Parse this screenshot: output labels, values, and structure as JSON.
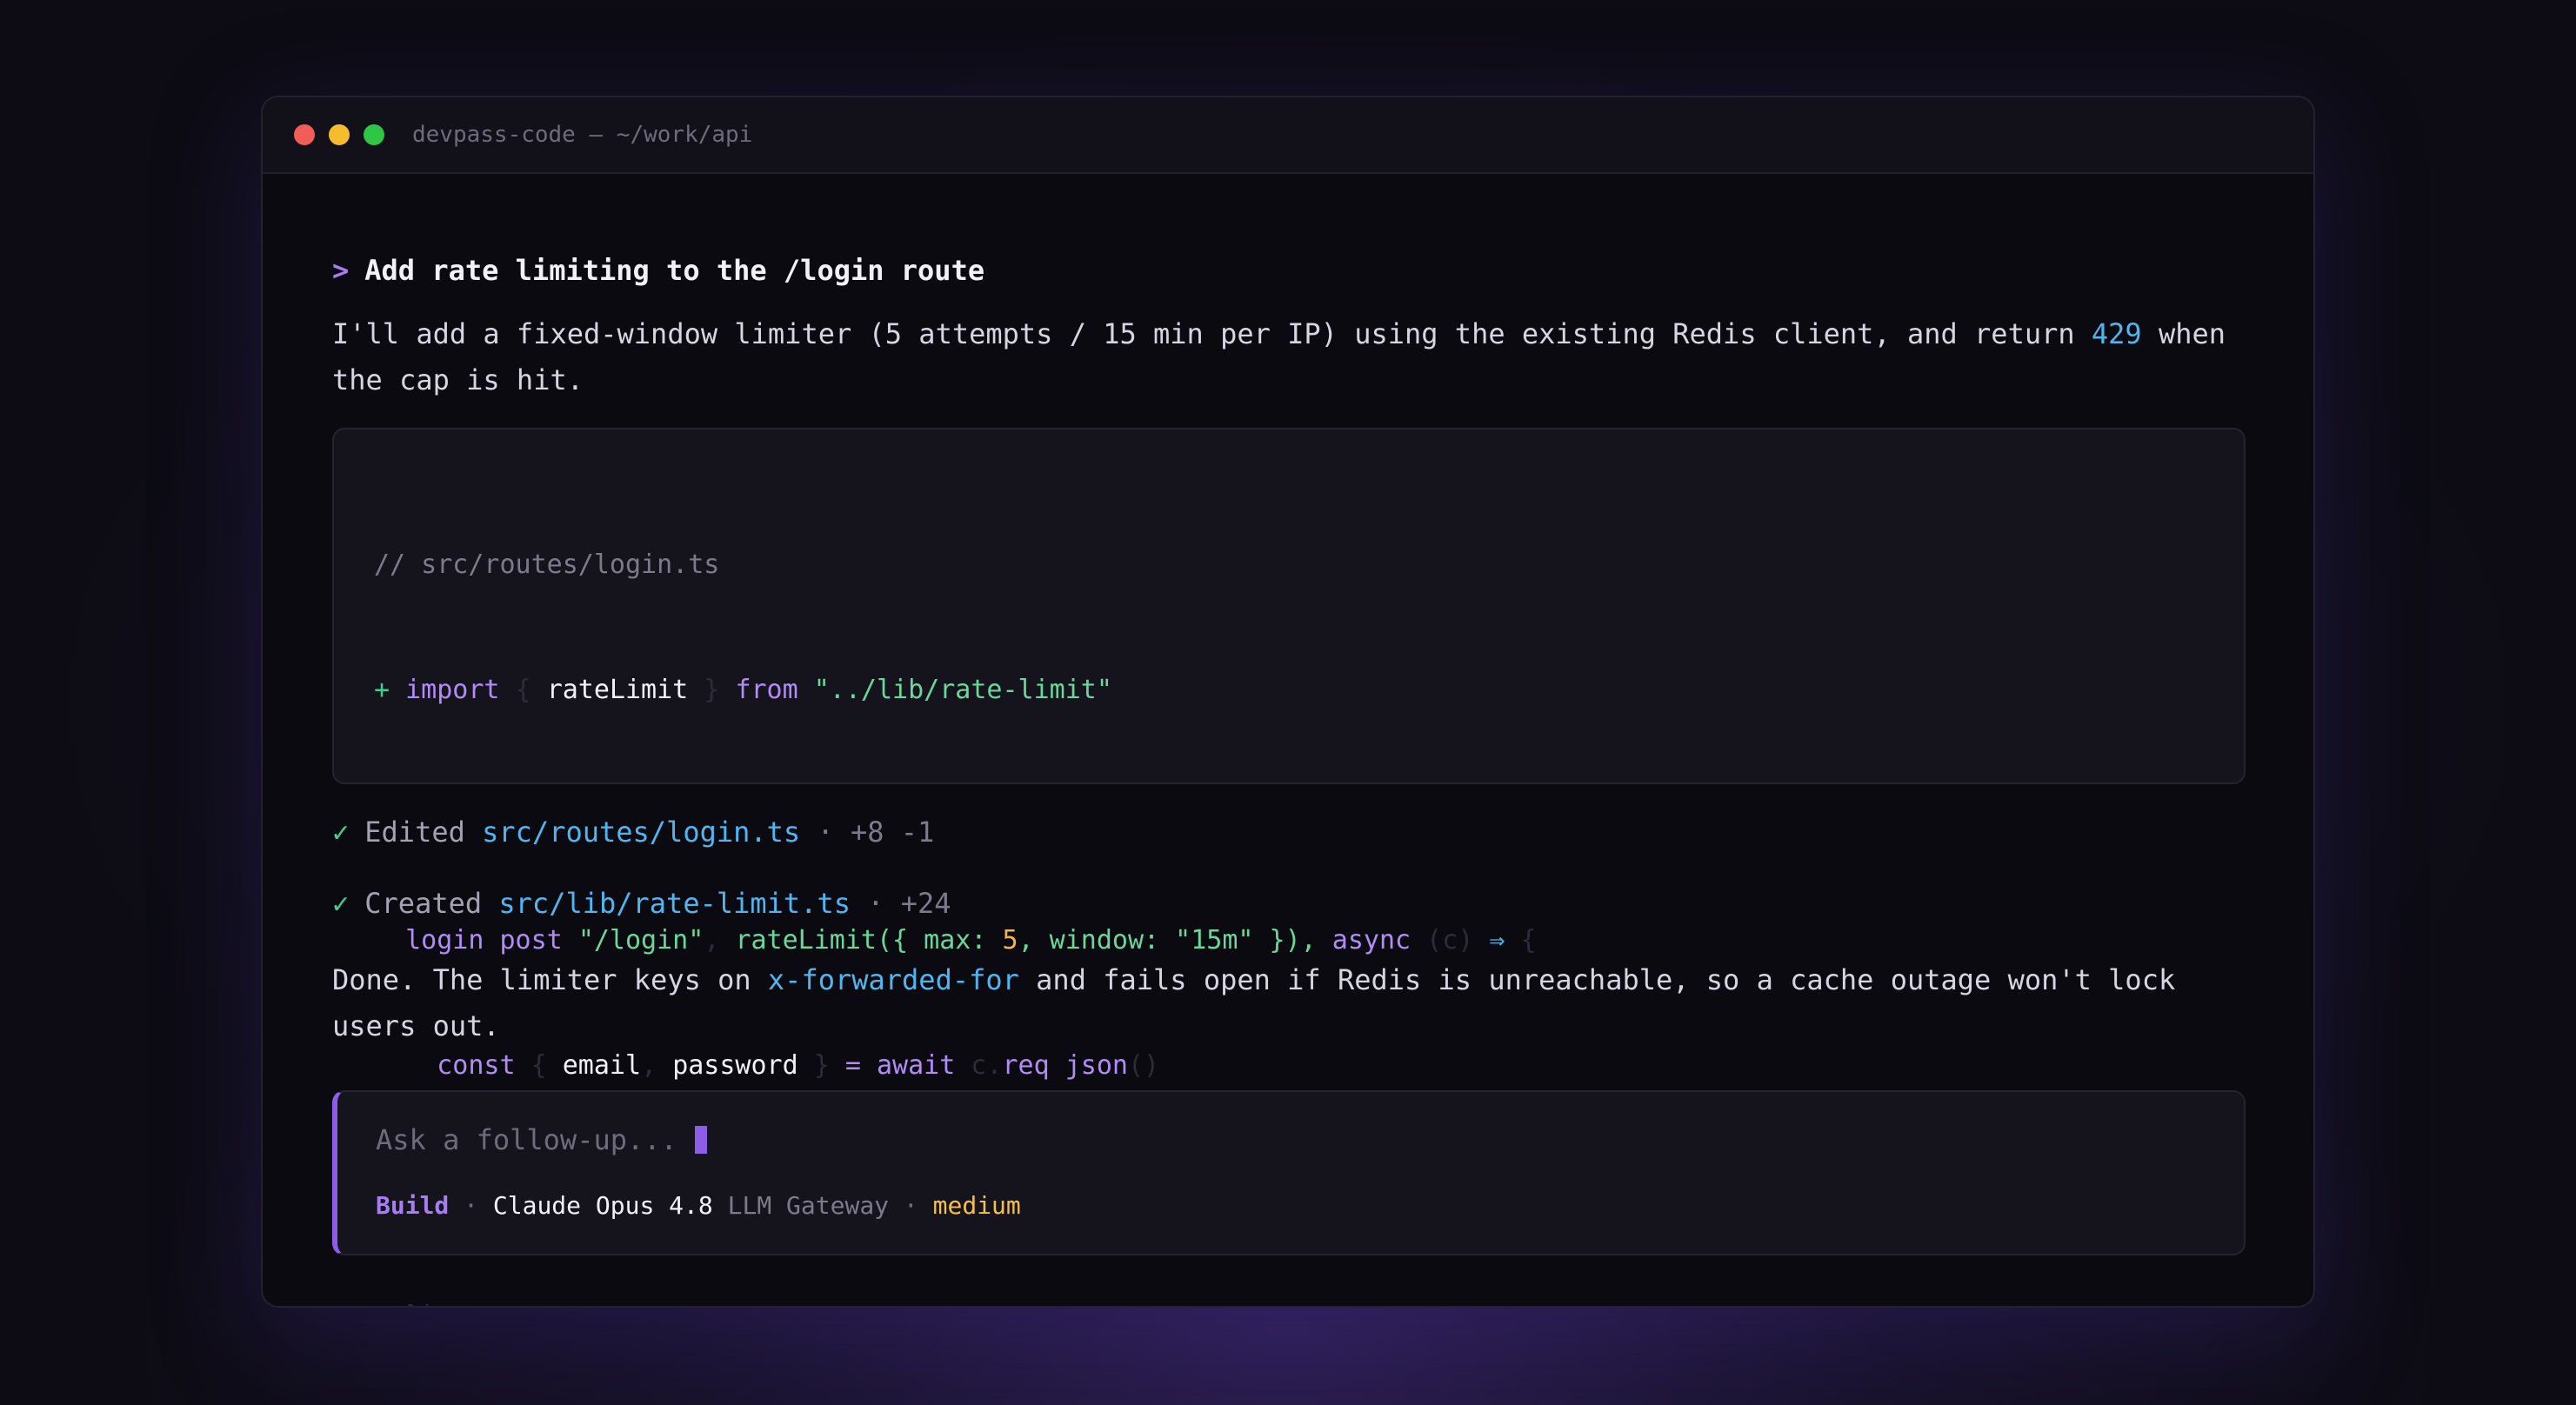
{
  "window": {
    "title": "devpass-code — ~/work/api"
  },
  "conversation": {
    "prompt_caret": ">",
    "prompt_text": "Add rate limiting to the /login route",
    "intro_part1": "I'll add a fixed-window limiter (5 attempts / 15 min per IP) using the existing Redis client, and return ",
    "intro_code": "429",
    "intro_part2": " when",
    "intro_line2": "the cap is hit.",
    "code": {
      "comment": "// src/routes/login.ts",
      "line2": {
        "plus": "+ ",
        "kw_import": "import",
        "brace_open": " { ",
        "ident": "rateLimit",
        "brace_close": " } ",
        "kw_from": "from",
        "space": " ",
        "str": "\"../lib/rate-limit\""
      },
      "line3": {
        "indent": "  ",
        "login_post": "login post",
        "space": " ",
        "route": "\"/login\"",
        "sep": ", ",
        "call": "rateLimit({ max: ",
        "max": "5",
        "window": ", window: ",
        "window_val": "\"15m\"",
        "close": " }), ",
        "kw_async": "async",
        "params": " (c) ",
        "arrow": "⇒",
        "brace": " {"
      },
      "line4": {
        "indent": "    ",
        "kw_const": "const",
        "brace_open": " { ",
        "email": "email",
        "comma": ", ",
        "password": "password",
        "brace_close": " } ",
        "assign": "= await",
        "space": " c.",
        "req_json": "req json",
        "parens": "()"
      },
      "line5": {
        "indent": "    ",
        "comment": "// ..."
      },
      "line6": {
        "indent": "  ",
        "close": "})"
      }
    },
    "edits": [
      {
        "check": "✓",
        "action": "Edited",
        "path": "src/routes/login.ts",
        "meta": " · +8 -1"
      },
      {
        "check": "✓",
        "action": "Created",
        "path": "src/lib/rate-limit.ts",
        "meta": " · +24"
      }
    ],
    "summary_part1": "Done. The limiter keys on ",
    "summary_code": "x-forwarded-for",
    "summary_part2": " and fails open if Redis is unreachable, so a cache outage won't lock",
    "summary_line2": "users out."
  },
  "input": {
    "placeholder": "Ask a follow-up...",
    "mode": "Build",
    "sep1": " · ",
    "model": "Claude Opus 4.8",
    "gateway": " LLM Gateway",
    "sep2": " · ",
    "effort": "medium"
  },
  "colors": {
    "accent": "#8d5de8",
    "success": "#3fcf8e",
    "link": "#4fb6ef",
    "warning": "#f4c04b"
  }
}
